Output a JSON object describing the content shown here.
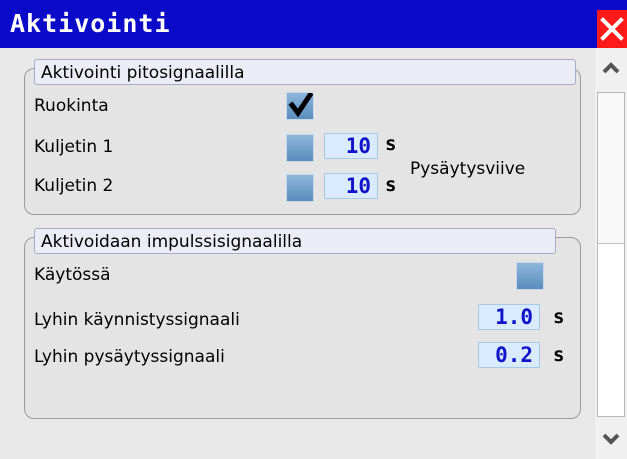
{
  "window": {
    "title": "Aktivointi"
  },
  "group1": {
    "title": "Aktivointi pitosignaalilla",
    "rows": [
      {
        "label": "Ruokinta",
        "checked": true
      },
      {
        "label": "Kuljetin 1",
        "checked": false,
        "value": "10",
        "unit": "s"
      },
      {
        "label": "Kuljetin 2",
        "checked": false,
        "value": "10",
        "unit": "s"
      }
    ],
    "side_label": "Pysäytysviive"
  },
  "group2": {
    "title": "Aktivoidaan impulssisignaalilla",
    "enabled_label": "Käytössä",
    "enabled_checked": false,
    "rows": [
      {
        "label": "Lyhin käynnistyssignaali",
        "value": "1.0",
        "unit": "s"
      },
      {
        "label": "Lyhin pysäytyssignaali",
        "value": "0.2",
        "unit": "s"
      }
    ]
  },
  "colors": {
    "titlebar": "#0a0ac8",
    "close": "#ff1a1a",
    "value_text": "#1212c8",
    "value_bg": "#d9ecff",
    "checkbox": "#6f9ccb"
  },
  "icons": {
    "close": "close-icon",
    "check": "checkmark-icon",
    "scroll_up": "chevron-up-icon",
    "scroll_down": "chevron-down-icon"
  }
}
